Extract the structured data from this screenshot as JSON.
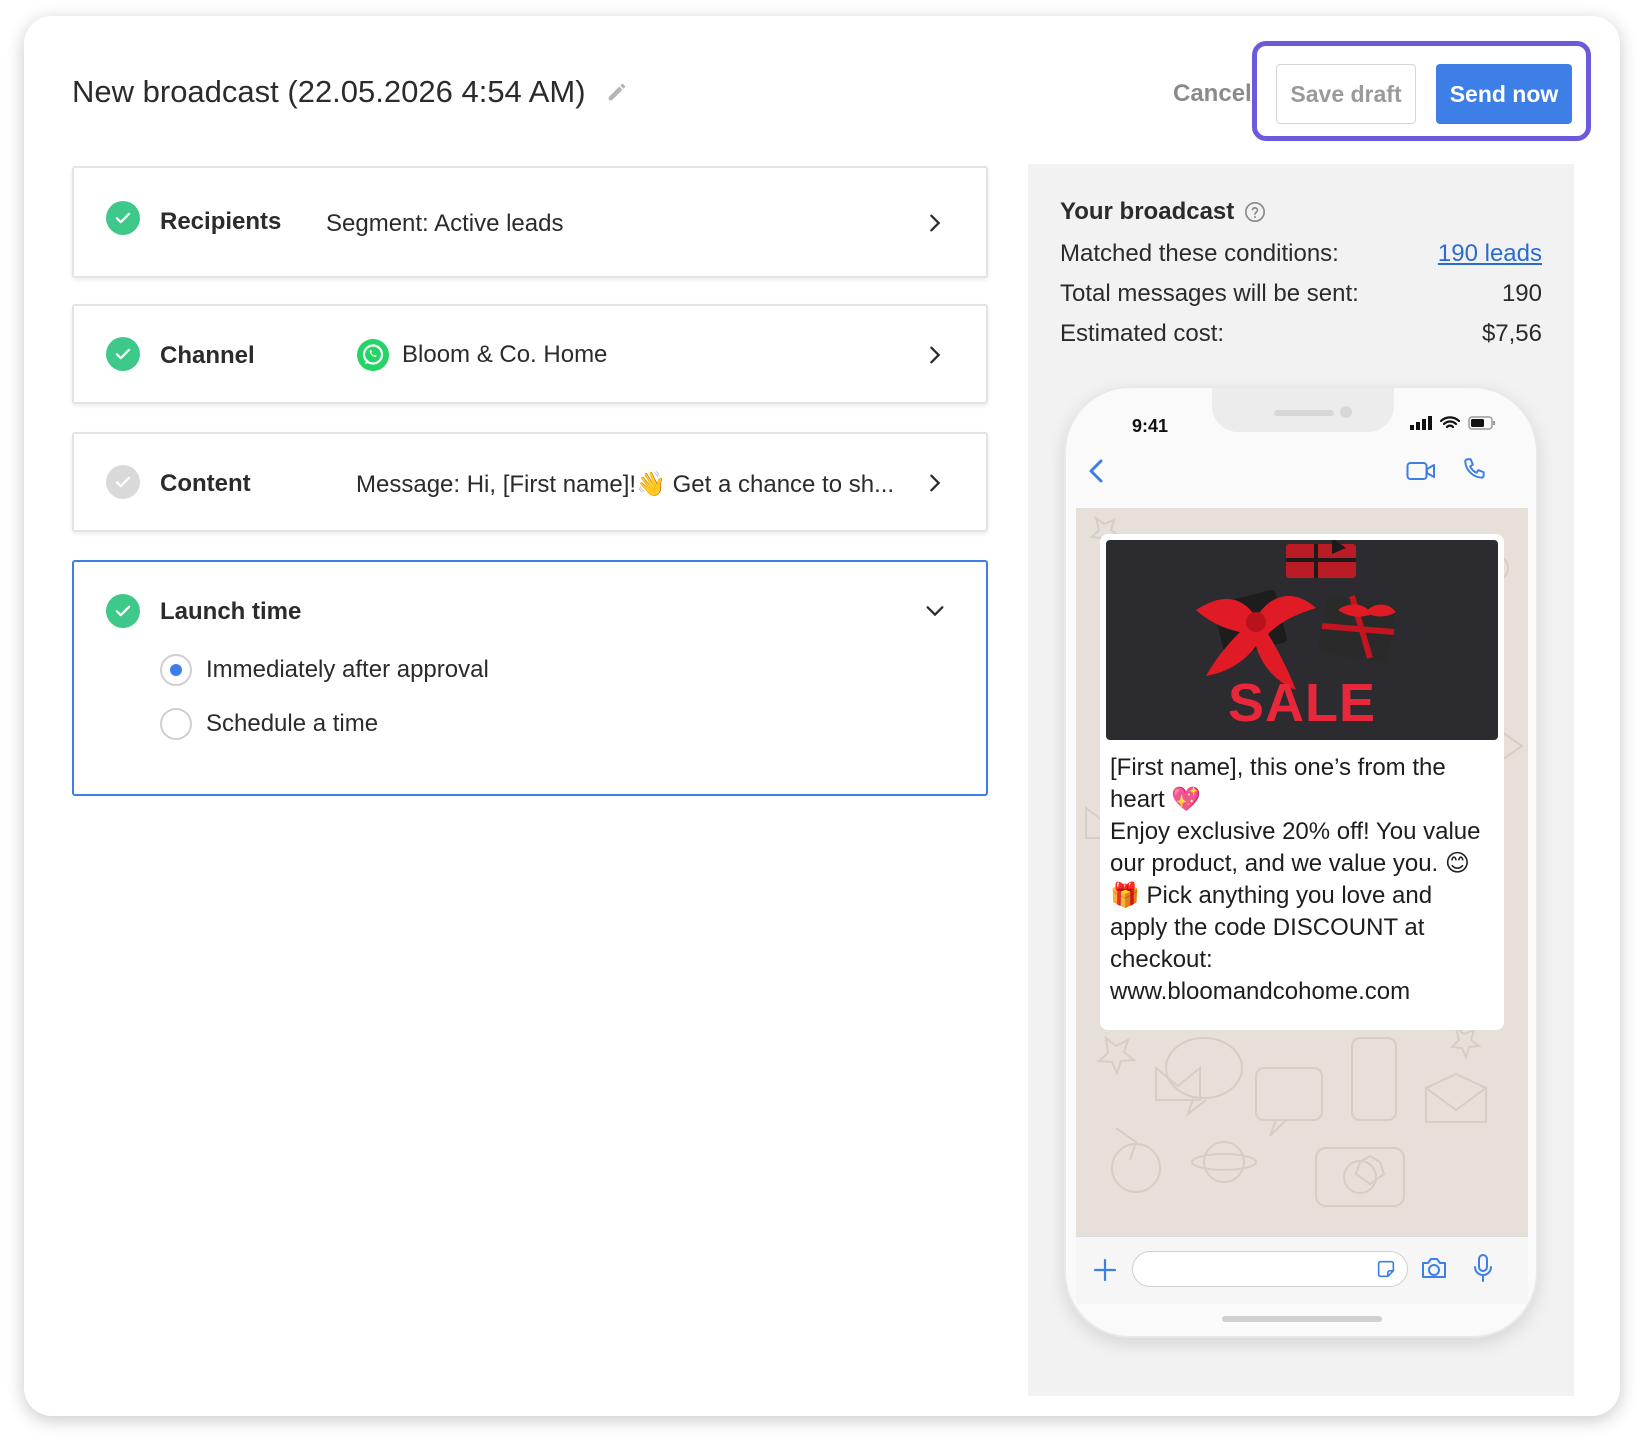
{
  "header": {
    "title": "New broadcast (22.05.2026 4:54 AM)",
    "cancel_label": "Cancel",
    "save_draft_label": "Save draft",
    "send_now_label": "Send now"
  },
  "steps": {
    "recipients": {
      "label": "Recipients",
      "value": "Segment: Active leads",
      "status": "done"
    },
    "channel": {
      "label": "Channel",
      "value": "Bloom & Co. Home",
      "status": "done",
      "icon": "whatsapp-icon"
    },
    "content": {
      "label": "Content",
      "value": "Message: Hi, [First name]!👋 Get a chance to sh...",
      "status": "pending"
    },
    "launch": {
      "label": "Launch time",
      "status": "done",
      "options": [
        {
          "label": "Immediately after approval",
          "selected": true
        },
        {
          "label": "Schedule a time",
          "selected": false
        }
      ]
    }
  },
  "summary": {
    "title": "Your broadcast",
    "matched_label": "Matched these conditions:",
    "matched_value": "190 leads",
    "total_label": "Total messages will be sent:",
    "total_value": "190",
    "cost_label": "Estimated cost:",
    "cost_value": "$7,56"
  },
  "phone": {
    "time": "9:41",
    "image_text": "SALE",
    "message": "[First name], this one’s from the heart 💖\nEnjoy exclusive 20% off! You value our product, and we value you. 😊\n🎁 Pick anything you love and apply the code DISCOUNT at checkout:\nwww.bloomandcohome.com"
  },
  "colors": {
    "accent": "#3d7fe6",
    "highlight": "#6b5bdc",
    "success": "#3ec98a",
    "pending": "#d9d9d9",
    "sale_red": "#e8283a"
  }
}
